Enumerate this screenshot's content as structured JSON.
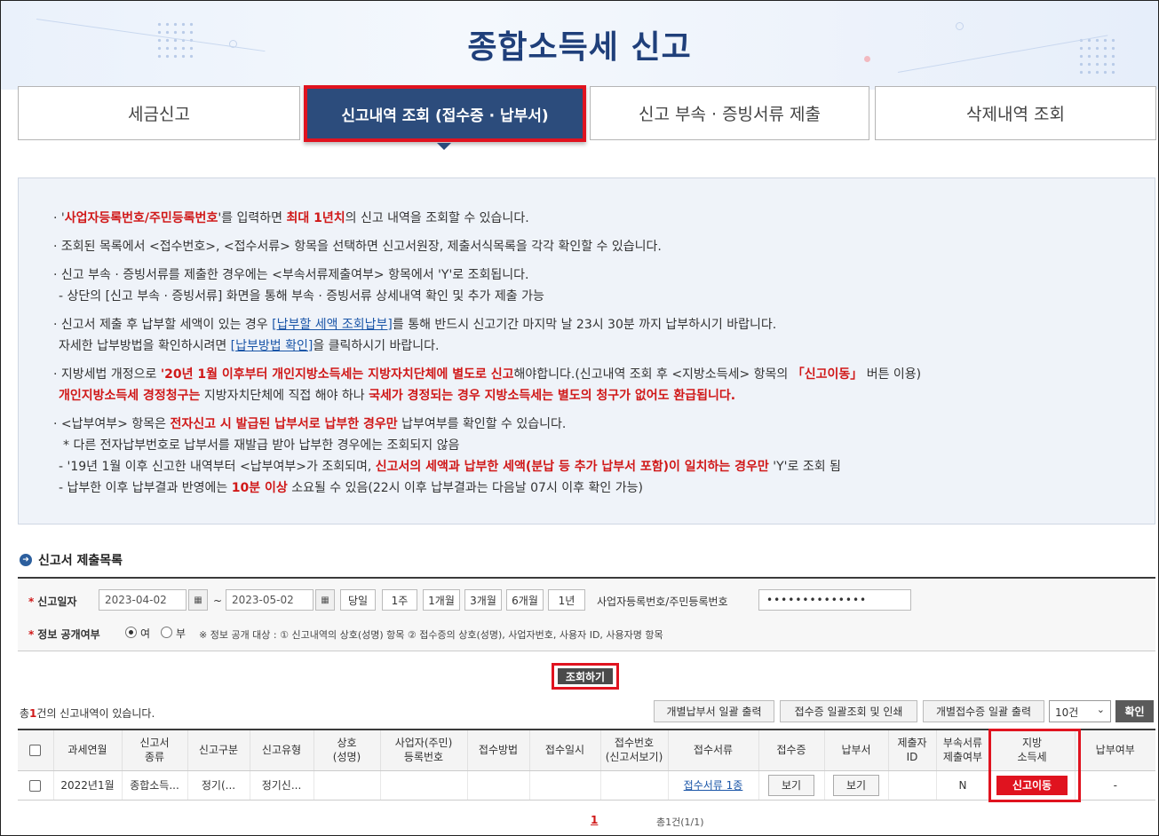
{
  "page_title": "종합소득세 신고",
  "tabs": [
    {
      "label": "세금신고"
    },
    {
      "label": "신고내역 조회 (접수증 · 납부서)"
    },
    {
      "label": "신고 부속 · 증빙서류 제출"
    },
    {
      "label": "삭제내역 조회"
    }
  ],
  "notices": {
    "n1": {
      "a": "'",
      "b": "사업자등록번호/주민등록번호",
      "c": "'를 입력하면 ",
      "d": "최대 1년치",
      "e": "의 신고 내역을 조회할 수 있습니다."
    },
    "n2": "조회된 목록에서 <접수번호>, <접수서류> 항목을 선택하면 신고서원장, 제출서식목록을 각각 확인할 수 있습니다.",
    "n3a": "신고 부속 · 증빙서류를 제출한 경우에는 <부속서류제출여부> 항목에서 'Y'로 조회됩니다.",
    "n3b": "- 상단의 [신고 부속 · 증빙서류] 화면을 통해 부속 · 증빙서류 상세내역 확인 및 추가 제출 가능",
    "n4a": {
      "a": "신고서 제출 후 납부할 세액이 있는 경우 ",
      "link": "[납부할 세액 조회납부]",
      "b": "를 통해 반드시 신고기간 마지막 날 23시 30분 까지 납부하시기 바랍니다."
    },
    "n4b": {
      "a": "자세한 납부방법을 확인하시려면 ",
      "link": "[납부방법 확인]",
      "b": "을 클릭하시기 바랍니다."
    },
    "n5a": {
      "a": "지방세법 개정으로 ",
      "red1": "'20년 1월 이후부터 개인지방소득세는 지방자치단체에 별도로 신고",
      "b": "해야합니다.(신고내역 조회 후 <지방소득세> 항목의 ",
      "red2": "「신고이동」",
      "c": " 버튼 이용)"
    },
    "n5b": {
      "red1": "개인지방소득세 경정청구는",
      "a": " 지방자치단체에 직접 해야 하나 ",
      "red2": "국세가 경정되는 경우 지방소득세는 별도의 청구가 없어도 환급됩니다."
    },
    "n6a": {
      "a": "<납부여부> 항목은 ",
      "red": "전자신고 시 발급된 납부서로 납부한 경우만",
      "b": " 납부여부를 확인할 수 있습니다."
    },
    "n6b": "* 다른 전자납부번호로 납부서를 재발급 받아 납부한 경우에는 조회되지 않음",
    "n6c": {
      "a": "- '19년 1월 이후 신고한 내역부터 <납부여부>가 조회되며, ",
      "red": "신고서의 세액과 납부한 세액(분납 등 추가 납부서 포함)이 일치하는 경우만",
      "b": " 'Y'로 조회 됨"
    },
    "n6d": {
      "a": "- 납부한 이후 납부결과 반영에는 ",
      "red": "10분 이상",
      "b": " 소요될 수 있음(22시 이후 납부결과는 다음날 07시 이후 확인 가능)"
    }
  },
  "section_title": "신고서 제출목록",
  "search": {
    "date_label": "신고일자",
    "date_from": "2023-04-02",
    "date_to": "2023-05-02",
    "tilde": "~",
    "periods": [
      "당일",
      "1주",
      "1개월",
      "3개월",
      "6개월",
      "1년"
    ],
    "id_label": "사업자등록번호/주민등록번호",
    "id_value": "••••••••••••••",
    "disclose_label": "정보 공개여부",
    "radio_yes": "여",
    "radio_no": "부",
    "disclose_note": "※ 정보 공개 대상 : ① 신고내역의 상호(성명) 항목 ② 접수증의 상호(성명), 사업자번호, 사용자 ID, 사용자명 항목"
  },
  "lookup_button": "조회하기",
  "result": {
    "count_prefix": "총",
    "count": "1",
    "count_suffix": "건의 신고내역이 있습니다.",
    "actions": [
      "개별납부서 일괄 출력",
      "접수증 일괄조회 및 인쇄",
      "개별접수증 일괄 출력"
    ],
    "page_size": "10건",
    "confirm": "확인"
  },
  "table": {
    "headers": [
      "",
      "과세연월",
      "신고서\n종류",
      "신고구분",
      "신고유형",
      "상호\n(성명)",
      "사업자(주민)\n등록번호",
      "접수방법",
      "접수일시",
      "접수번호\n(신고서보기)",
      "접수서류",
      "접수증",
      "납부서",
      "제출자\nID",
      "부속서류\n제출여부",
      "지방\n소득세",
      "납부여부"
    ],
    "row": {
      "period": "2022년1월",
      "kind": "종합소득...",
      "category": "정기(...",
      "type": "정기신...",
      "name": "",
      "regno": "",
      "method": "",
      "datetime": "",
      "receipt_no": "",
      "docs": "접수서류 1종",
      "receipt_btn": "보기",
      "bill_btn": "보기",
      "submitter": "",
      "attach": "N",
      "local_btn": "신고이동",
      "paid": "-"
    }
  },
  "pager": {
    "current": "1",
    "total": "총1건(1/1)"
  },
  "colors": {
    "navy": "#2c4c7c",
    "highlight_red": "#e0131f",
    "text_red": "#d01818"
  }
}
